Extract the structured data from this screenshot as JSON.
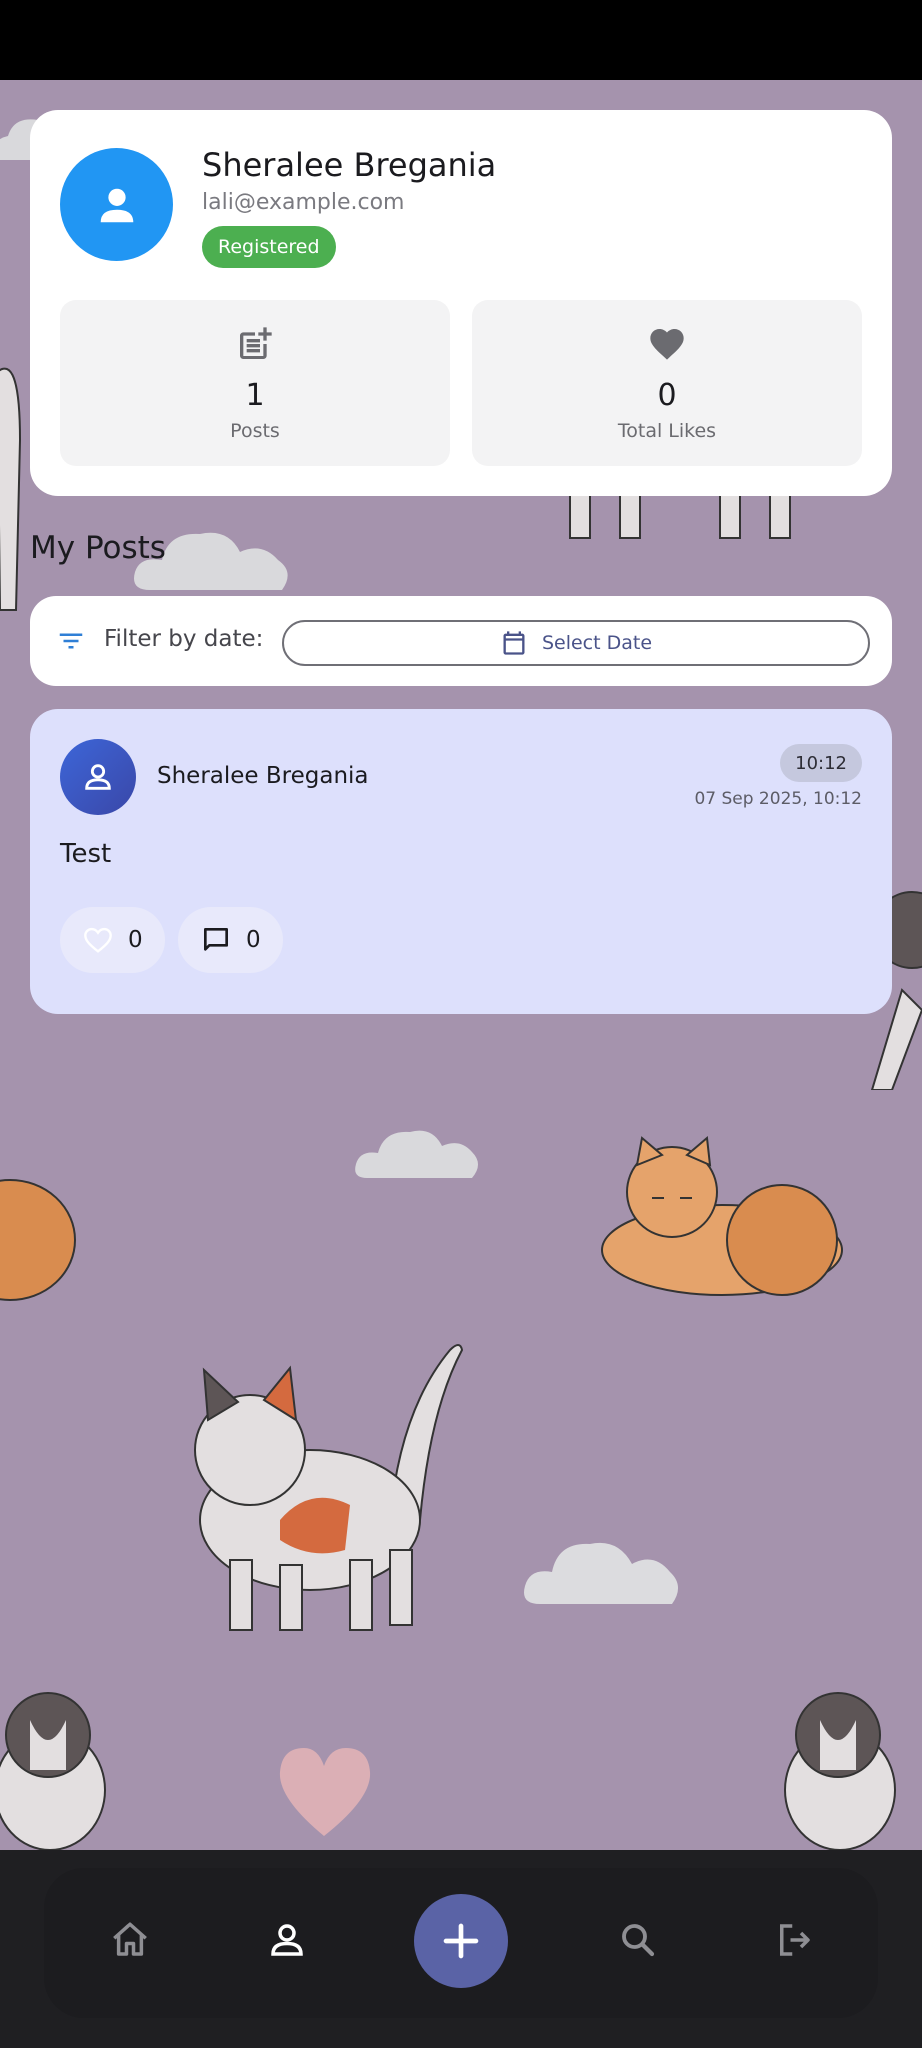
{
  "profile": {
    "name": "Sheralee Bregania",
    "email": "lali@example.com",
    "badge": "Registered",
    "stats": [
      {
        "icon": "post-add-icon",
        "value": "1",
        "label": "Posts"
      },
      {
        "icon": "heart-icon",
        "value": "0",
        "label": "Total Likes"
      }
    ]
  },
  "section": {
    "title": "My Posts"
  },
  "filter": {
    "label": "Filter by date:",
    "button_label": "Select Date",
    "icon": "filter-icon",
    "button_icon": "calendar-icon"
  },
  "posts": [
    {
      "author": "Sheralee Bregania",
      "time_chip": "10:12",
      "datetime": "07 Sep 2025, 10:12",
      "body": "Test",
      "likes": "0",
      "comments": "0"
    }
  ],
  "nav": {
    "items": [
      "home-icon",
      "profile-icon",
      "add-icon",
      "search-icon",
      "logout-icon"
    ],
    "active": "profile-icon",
    "fab_color": "#5a63a6"
  },
  "colors": {
    "wallpaper": "#a593ad",
    "avatar": "#2196f3",
    "badge": "#4caf50",
    "post_card": "#dde0fc"
  }
}
